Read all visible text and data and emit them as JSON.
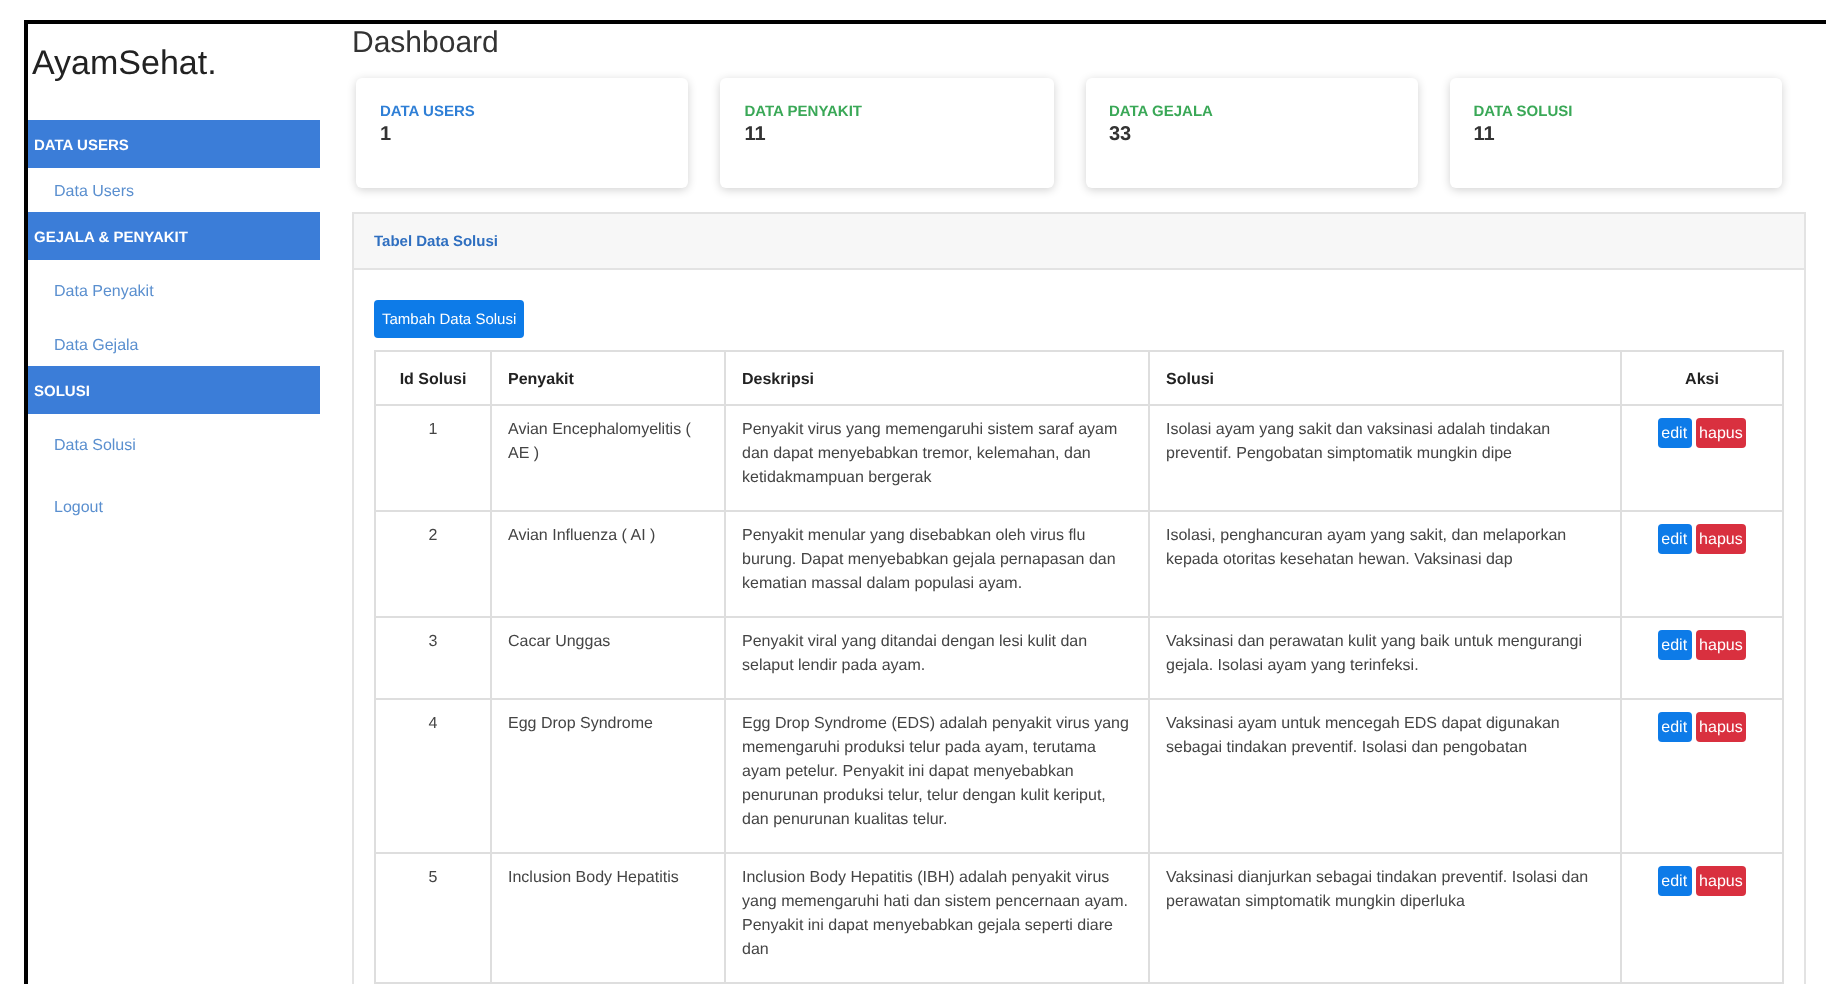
{
  "brand": "AyamSehat.",
  "sidebar": {
    "items": [
      {
        "kind": "header",
        "label": "DATA USERS"
      },
      {
        "kind": "link",
        "label": "Data Users"
      },
      {
        "kind": "header",
        "label": "GEJALA & PENYAKIT"
      },
      {
        "kind": "link",
        "label": "Data Penyakit"
      },
      {
        "kind": "link",
        "label": "Data Gejala"
      },
      {
        "kind": "header",
        "label": "SOLUSI"
      },
      {
        "kind": "link",
        "label": "Data Solusi"
      },
      {
        "kind": "link",
        "label": "Logout"
      }
    ]
  },
  "page_title": "Dashboard",
  "stats": [
    {
      "label": "DATA USERS",
      "value": "1",
      "color": "#2f7fd6"
    },
    {
      "label": "DATA PENYAKIT",
      "value": "11",
      "color": "#3aa857"
    },
    {
      "label": "DATA GEJALA",
      "value": "33",
      "color": "#3aa857"
    },
    {
      "label": "DATA SOLUSI",
      "value": "11",
      "color": "#3aa857"
    }
  ],
  "panel": {
    "title": "Tabel Data Solusi",
    "add_button": "Tambah Data Solusi"
  },
  "table": {
    "columns": [
      "Id Solusi",
      "Penyakit",
      "Deskripsi",
      "Solusi",
      "Aksi"
    ],
    "rows": [
      {
        "id": "1",
        "penyakit": "Avian Encephalomyelitis ( AE )",
        "deskripsi": "Penyakit virus yang memengaruhi sistem saraf ayam dan dapat menyebabkan tremor, kelemahan, dan ketidakmampuan bergerak",
        "solusi": "Isolasi ayam yang sakit dan vaksinasi adalah tindakan preventif. Pengobatan simptomatik mungkin dipe",
        "actions": [
          "edit",
          "hapus"
        ]
      },
      {
        "id": "2",
        "penyakit": "Avian Influenza ( AI )",
        "deskripsi": "Penyakit menular yang disebabkan oleh virus flu burung. Dapat menyebabkan gejala pernapasan dan kematian massal dalam populasi ayam.",
        "solusi": "Isolasi, penghancuran ayam yang sakit, dan melaporkan kepada otoritas kesehatan hewan. Vaksinasi dap",
        "actions": [
          "edit",
          "hapus"
        ]
      },
      {
        "id": "3",
        "penyakit": "Cacar Unggas",
        "deskripsi": "Penyakit viral yang ditandai dengan lesi kulit dan selaput lendir pada ayam.",
        "solusi": "Vaksinasi dan perawatan kulit yang baik untuk mengurangi gejala. Isolasi ayam yang terinfeksi.",
        "actions": [
          "edit",
          "hapus"
        ]
      },
      {
        "id": "4",
        "penyakit": "Egg Drop Syndrome",
        "deskripsi": "Egg Drop Syndrome (EDS) adalah penyakit virus yang memengaruhi produksi telur pada ayam, terutama ayam petelur. Penyakit ini dapat menyebabkan penurunan produksi telur, telur dengan kulit keriput, dan penurunan kualitas telur.",
        "solusi": "Vaksinasi ayam untuk mencegah EDS dapat digunakan sebagai tindakan preventif. Isolasi dan pengobatan",
        "actions": [
          "edit",
          "hapus"
        ]
      },
      {
        "id": "5",
        "penyakit": "Inclusion Body Hepatitis",
        "deskripsi": "Inclusion Body Hepatitis (IBH) adalah penyakit virus yang memengaruhi hati dan sistem pencernaan ayam. Penyakit ini dapat menyebabkan gejala seperti diare dan",
        "solusi": "Vaksinasi dianjurkan sebagai tindakan preventif. Isolasi dan perawatan simptomatik mungkin diperluka",
        "actions": [
          "edit",
          "hapus"
        ]
      }
    ]
  }
}
